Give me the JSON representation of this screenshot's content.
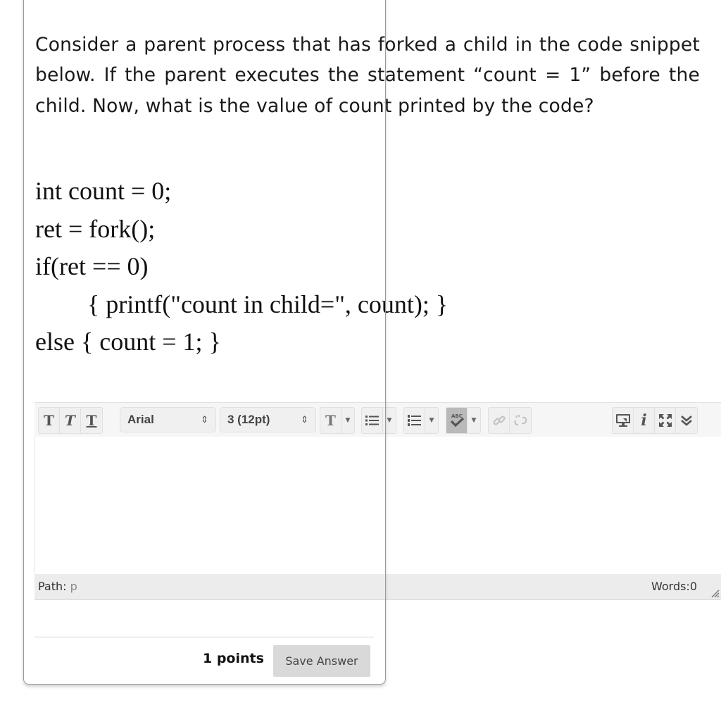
{
  "question": {
    "text": "Consider a parent process that has forked a child in the code snippet below. If the parent executes the statement “count = 1” before the child. Now, what is the value of count printed by the code?",
    "code_lines": [
      "int count = 0;",
      "ret = fork();",
      "if(ret == 0)",
      "{ printf(\"count in child=\", count); }",
      "else { count = 1; }"
    ]
  },
  "editor": {
    "toolbar": {
      "bold_label": "T",
      "italic_label": "T",
      "underline_label": "T",
      "font_family": "Arial",
      "font_size": "3 (12pt)",
      "text_color_label": "T",
      "icons": [
        "bold-icon",
        "italic-icon",
        "underline-icon",
        "text-color-icon",
        "bullet-list-icon",
        "numbered-list-icon",
        "spellcheck-icon",
        "link-icon",
        "unlink-icon",
        "preview-icon",
        "info-icon",
        "fullscreen-icon",
        "expand-toolbar-icon"
      ]
    },
    "content": "",
    "status": {
      "path_label": "Path:",
      "path_value": "p",
      "words": "Words:0"
    }
  },
  "footer": {
    "points": "1 points",
    "save_label": "Save Answer"
  },
  "colors": {
    "toolbar_bg": "#f6f6f6",
    "active_button": "#b9b9b9",
    "statusbar_bg": "#ececec",
    "save_button_bg": "#d9d9d9"
  }
}
